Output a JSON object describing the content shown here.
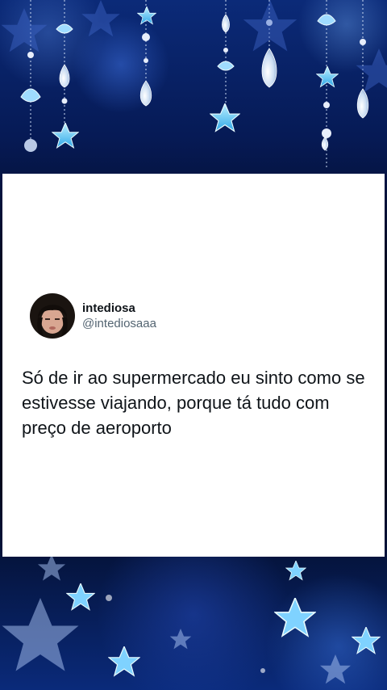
{
  "background": {
    "description_colors": {
      "deep": "#02081c",
      "mid": "#061a55",
      "glow": "#3c6edc",
      "star": "#5ec8ff"
    },
    "decorations": [
      "star-icon",
      "crystal-drop-icon",
      "shell-icon",
      "bead-chain"
    ]
  },
  "tweet": {
    "author": {
      "display_name": "intediosa",
      "handle": "@intediosaaa"
    },
    "text": "Só de ir ao supermercado eu sinto como se estivesse viajando, porque tá tudo com preço de aeroporto",
    "colors": {
      "text": "#0f1419",
      "secondary": "#536471",
      "card": "#ffffff"
    }
  }
}
